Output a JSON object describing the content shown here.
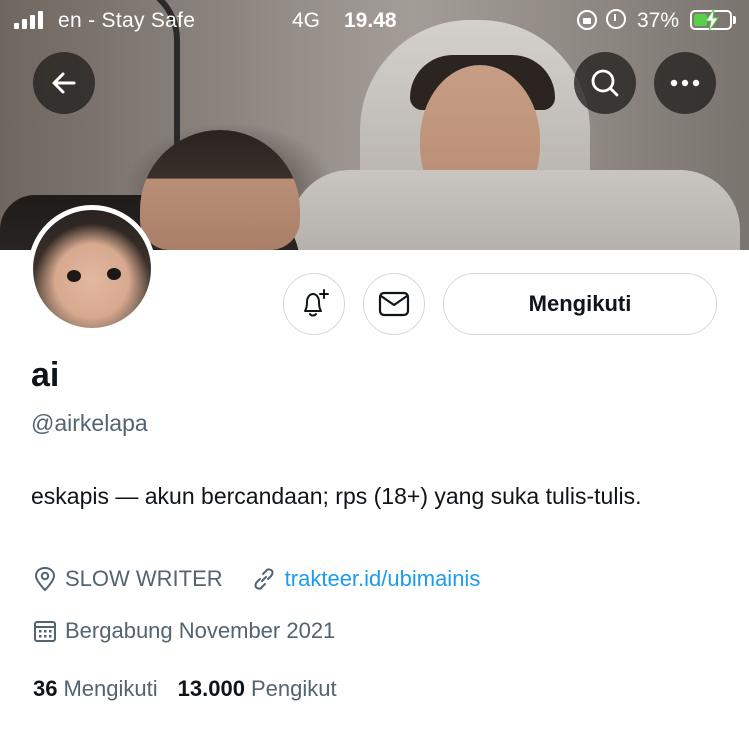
{
  "status_bar": {
    "carrier": "en - Stay Safe",
    "network": "4G",
    "time": "19.48",
    "battery_percent": "37%",
    "battery_level": 0.37,
    "charging": true
  },
  "header": {
    "icons": [
      "back-arrow-icon",
      "search-icon",
      "more-icon"
    ]
  },
  "profile": {
    "display_name": "ai",
    "handle": "@airkelapa",
    "bio": "eskapis — akun bercandaan; rps (18+) yang suka tulis-tulis.",
    "location": "SLOW WRITER",
    "website": "trakteer.id/ubimainis",
    "joined": "Bergabung November 2021"
  },
  "actions": {
    "follow_label": "Mengikuti"
  },
  "stats": {
    "following_count": "36",
    "following_label": "Mengikuti",
    "followers_count": "13.000",
    "followers_label": "Pengikut"
  },
  "colors": {
    "link": "#1d9bf0",
    "secondary_text": "#536471",
    "primary_text": "#0f1419",
    "border": "#cfd9de"
  }
}
